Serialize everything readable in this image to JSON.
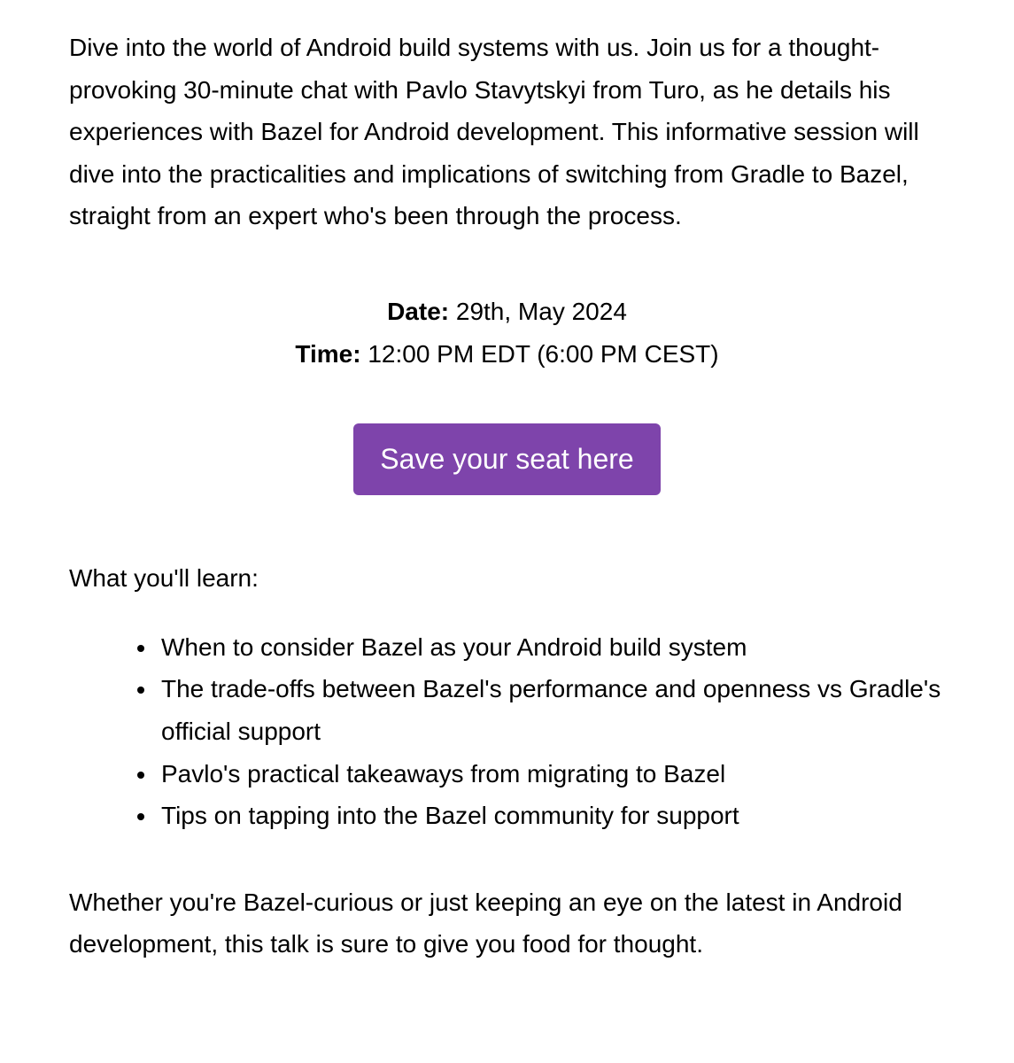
{
  "intro": "Dive into the world of Android build systems with us. Join us for a thought-provoking 30-minute chat with Pavlo Stavytskyi from Turo, as he details his experiences with Bazel for Android development. This informative session will dive into the practicalities and implications of switching from Gradle to Bazel, straight from an expert who's been through the process.",
  "datetime": {
    "date_label": "Date:",
    "date_value": " 29th, May 2024",
    "time_label": "Time:",
    "time_value": " 12:00 PM EDT (6:00 PM CEST)"
  },
  "cta": {
    "label": "Save your seat here"
  },
  "learn": {
    "heading": "What you'll learn:",
    "items": [
      "When to consider Bazel as your Android build system",
      "The trade-offs between Bazel's performance and openness vs Gradle's official support",
      "Pavlo's practical takeaways from migrating to Bazel",
      "Tips on tapping into the Bazel community for support"
    ]
  },
  "outro": "Whether you're Bazel-curious or just keeping an eye on the latest in Android development, this talk is sure to give you food for thought.",
  "colors": {
    "accent": "#7e44ab"
  }
}
